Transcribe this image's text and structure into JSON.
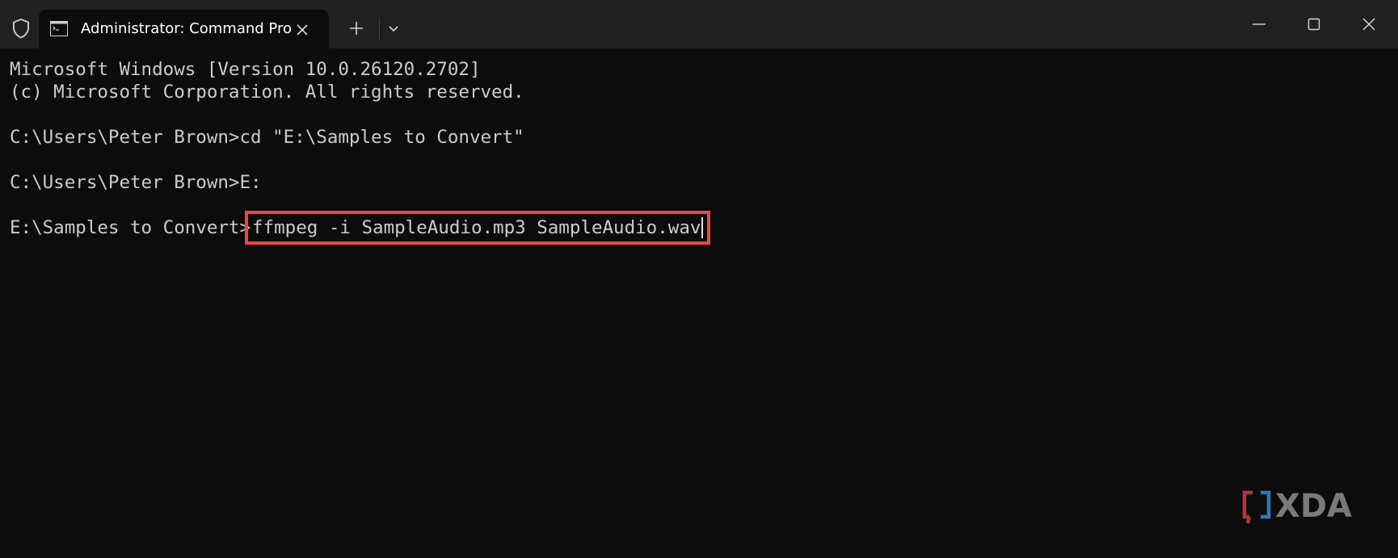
{
  "window": {
    "tab_title": "Administrator: Command Pro"
  },
  "icons": {
    "shield": "shield-icon",
    "tab": "command-prompt-icon",
    "tab_close": "close-icon",
    "new_tab": "plus-icon",
    "dropdown": "chevron-down-icon",
    "minimize": "minimize-icon",
    "maximize": "maximize-icon",
    "close": "close-icon"
  },
  "terminal": {
    "lines": [
      "Microsoft Windows [Version 10.0.26120.2702]",
      "(c) Microsoft Corporation. All rights reserved.",
      "C:\\Users\\Peter Brown>cd \"E:\\Samples to Convert\"",
      "C:\\Users\\Peter Brown>E:"
    ],
    "prompt": "E:\\Samples to Convert>",
    "current_command": "ffmpeg -i SampleAudio.mp3 SampleAudio.wav"
  },
  "watermark": {
    "text": "XDA"
  },
  "colors": {
    "terminal_bg": "#0c0c0c",
    "titlebar_bg": "#202020",
    "text": "#cccccc",
    "highlight_box": "#e8484d",
    "logo_red": "#b5333c",
    "logo_blue": "#2b7bb9",
    "logo_gray": "#7a7a7a"
  }
}
